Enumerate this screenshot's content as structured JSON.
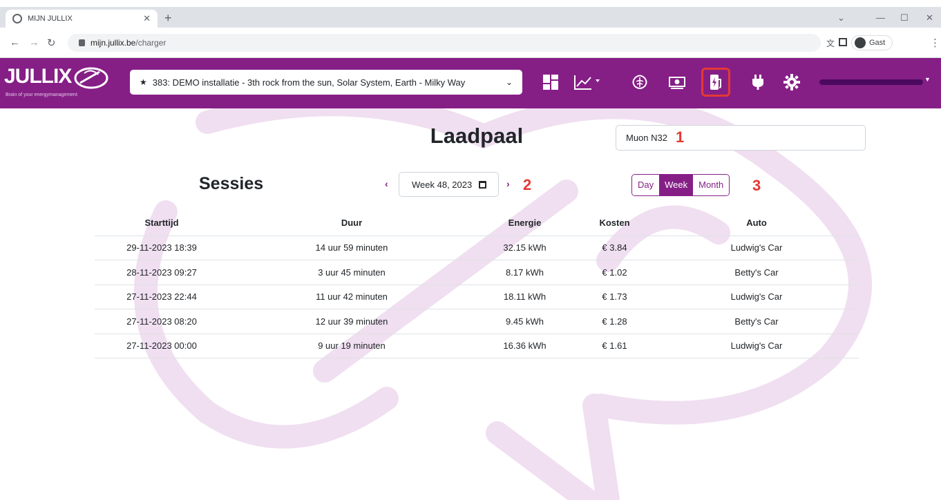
{
  "browser": {
    "tab_title": "MIJN JULLIX",
    "url_host": "mijn.jullix.be",
    "url_path": "/charger",
    "profile_label": "Gast"
  },
  "app": {
    "logo_text": "JULLIX",
    "logo_tagline": "Brain of your energymanagement",
    "installation_label": "383: DEMO installatie - 3th rock from the sun, Solar System, Earth - Milky Way",
    "nav_icons": [
      "dashboard-icon",
      "chart-icon",
      "brain-icon",
      "money-icon",
      "ev-charger-icon",
      "plug-icon",
      "gear-icon"
    ],
    "accent_color": "#851f86"
  },
  "page": {
    "title": "Laadpaal",
    "charger_value": "Muon N32",
    "sessions_title": "Sessies",
    "week_value": "Week 48, 2023",
    "period_options": [
      "Day",
      "Week",
      "Month"
    ],
    "period_selected": "Week",
    "markers": [
      "1",
      "2",
      "3"
    ]
  },
  "table": {
    "headers": [
      "Starttijd",
      "Duur",
      "Energie",
      "Kosten",
      "Auto"
    ],
    "rows": [
      [
        "29-11-2023 18:39",
        "14 uur 59 minuten",
        "32.15 kWh",
        "€ 3.84",
        "Ludwig's Car"
      ],
      [
        "28-11-2023 09:27",
        "3 uur 45 minuten",
        "8.17 kWh",
        "€ 1.02",
        "Betty's Car"
      ],
      [
        "27-11-2023 22:44",
        "11 uur 42 minuten",
        "18.11 kWh",
        "€ 1.73",
        "Ludwig's Car"
      ],
      [
        "27-11-2023 08:20",
        "12 uur 39 minuten",
        "9.45 kWh",
        "€ 1.28",
        "Betty's Car"
      ],
      [
        "27-11-2023 00:00",
        "9 uur 19 minuten",
        "16.36 kWh",
        "€ 1.61",
        "Ludwig's Car"
      ]
    ]
  }
}
